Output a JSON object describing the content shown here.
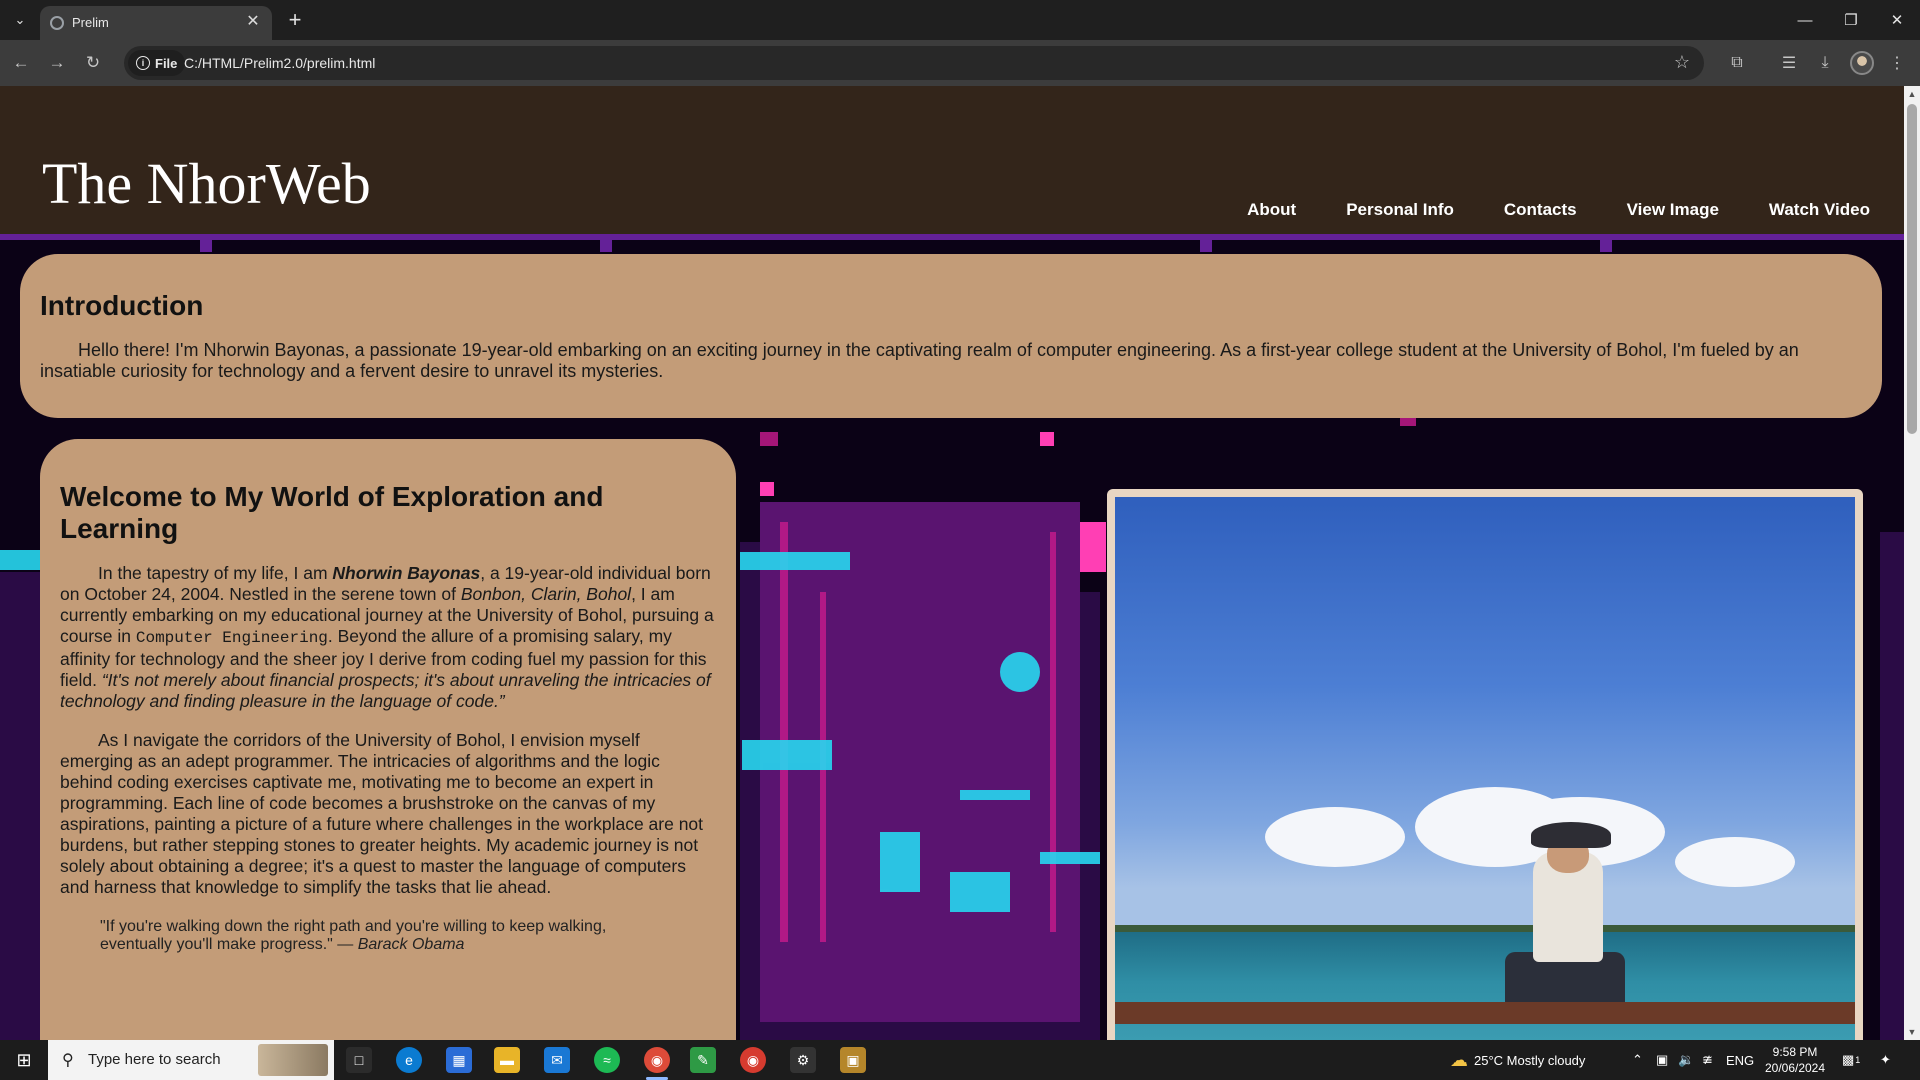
{
  "browser": {
    "tab_title": "Prelim",
    "url_chip": "File",
    "url": "C:/HTML/Prelim2.0/prelim.html"
  },
  "site": {
    "title": "The NhorWeb",
    "nav": [
      "About",
      "Personal Info",
      "Contacts",
      "View Image",
      "Watch Video"
    ]
  },
  "intro": {
    "heading": "Introduction",
    "text": "Hello there! I'm Nhorwin Bayonas, a passionate 19-year-old embarking on an exciting journey in the captivating realm of computer engineering. As a first-year college student at the University of Bohol, I'm fueled by an insatiable curiosity for technology and a fervent desire to unravel its mysteries."
  },
  "welcome": {
    "heading": "Welcome to My World of Exploration and Learning",
    "p1_a": "In the tapestry of my life, I am ",
    "p1_name": "Nhorwin Bayonas",
    "p1_b": ", a 19-year-old individual born on October 24, 2004. Nestled in the serene town of ",
    "p1_place": "Bonbon, Clarin, Bohol",
    "p1_c": ", I am currently embarking on my educational journey at the University of Bohol, pursuing a course in ",
    "p1_course": "Computer Engineering",
    "p1_d": ". Beyond the allure of a promising salary, my affinity for technology and the sheer joy I derive from coding fuel my passion for this field. ",
    "p1_quote": "“It's not merely about financial prospects; it's about unraveling the intricacies of technology and finding pleasure in the language of code.”",
    "p2": "As I navigate the corridors of the University of Bohol, I envision myself emerging as an adept programmer. The intricacies of algorithms and the logic behind coding exercises captivate me, motivating me to become an expert in programming. Each line of code becomes a brushstroke on the canvas of my aspirations, painting a picture of a future where challenges in the workplace are not burdens, but rather stepping stones to greater heights. My academic journey is not solely about obtaining a degree; it's a quest to master the language of computers and harness that knowledge to simplify the tasks that lie ahead.",
    "quote": "\"If you're walking down the right path and you're willing to keep walking, eventually you'll make progress.\" — ",
    "quote_author": "Barack Obama"
  },
  "taskbar": {
    "search_placeholder": "Type here to search",
    "weather": "25°C  Mostly cloudy",
    "lang": "ENG",
    "time": "9:58 PM",
    "date": "20/06/2024",
    "notification_count": "1"
  },
  "colors": {
    "header_bg": "#33251a",
    "card_bg": "#c39c78",
    "frame": "#e8d6c3"
  }
}
